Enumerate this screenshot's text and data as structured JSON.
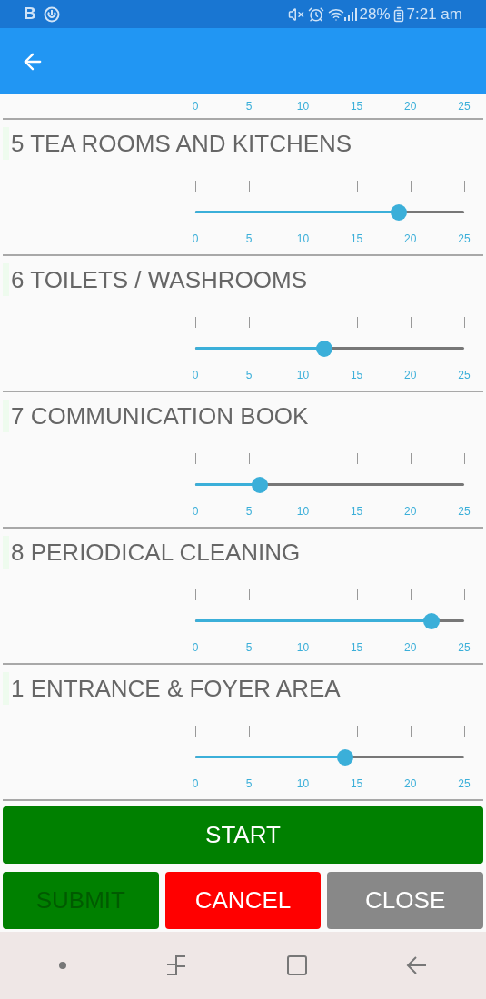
{
  "status_bar": {
    "notification_letter": "B",
    "battery": "28%",
    "time": "7:21 am"
  },
  "top_scale": [
    "0",
    "5",
    "10",
    "15",
    "20",
    "25"
  ],
  "sections": [
    {
      "title": "5 TEA ROOMS AND KITCHENS",
      "level": 0.757,
      "scale": [
        "0",
        "5",
        "10",
        "15",
        "20",
        "25"
      ]
    },
    {
      "title": "6 TOILETS / WASHROOMS",
      "level": 0.48,
      "scale": [
        "0",
        "5",
        "10",
        "15",
        "20",
        "25"
      ]
    },
    {
      "title": "7 COMMUNICATION BOOK",
      "level": 0.24,
      "scale": [
        "0",
        "5",
        "10",
        "15",
        "20",
        "25"
      ]
    },
    {
      "title": "8 PERIODICAL CLEANING",
      "level": 0.88,
      "scale": [
        "0",
        "5",
        "10",
        "15",
        "20",
        "25"
      ]
    },
    {
      "title": "1 ENTRANCE & FOYER AREA",
      "level": 0.557,
      "scale": [
        "0",
        "5",
        "10",
        "15",
        "20",
        "25"
      ]
    }
  ],
  "start_button": {
    "label": "START",
    "disabled": false
  },
  "buttons": [
    {
      "label": "SUBMIT",
      "kind": "submit",
      "disabled": true
    },
    {
      "label": "CANCEL",
      "kind": "cancel",
      "disabled": false
    },
    {
      "label": "CLOSE",
      "kind": "close",
      "disabled": false
    }
  ]
}
